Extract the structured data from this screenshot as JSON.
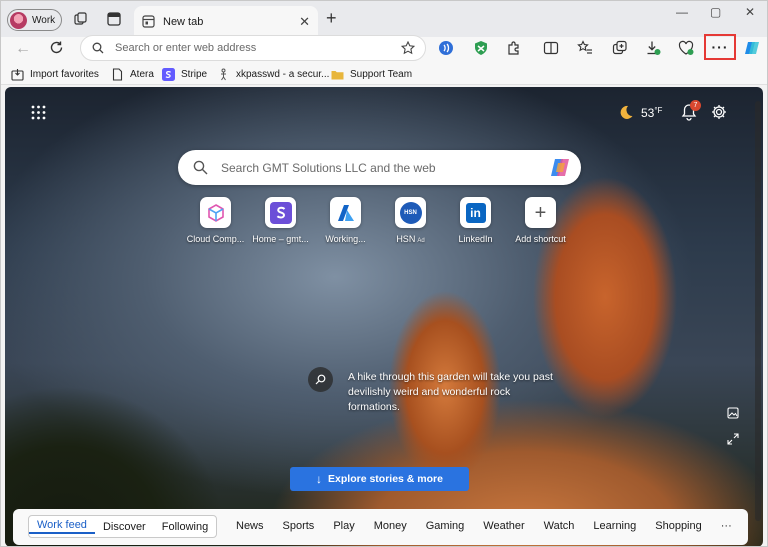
{
  "profile": {
    "label": "Work"
  },
  "tab": {
    "title": "New tab"
  },
  "window": {
    "minimize": "—",
    "restore": "▢",
    "close": "✕"
  },
  "toolbar": {
    "address_placeholder": "Search or enter web address",
    "more_label": "···"
  },
  "favorites": [
    {
      "label": "Import favorites"
    },
    {
      "label": "Atera"
    },
    {
      "label": "Stripe"
    },
    {
      "label": "xkpasswd - a secur..."
    },
    {
      "label": "Support Team"
    }
  ],
  "ntp": {
    "weather": {
      "temp": "53",
      "unit": "°F"
    },
    "notifications_count": "7",
    "search_placeholder": "Search GMT Solutions LLC and the web",
    "shortcuts": [
      {
        "label": "Cloud Comp...",
        "icon": "cube-icon"
      },
      {
        "label": "Home – gmt...",
        "icon": "s-letter-icon"
      },
      {
        "label": "Working...",
        "icon": "azure-icon"
      },
      {
        "label": "HSN",
        "ad": "Ad",
        "icon": "hsn-icon",
        "tile_text": "HSN"
      },
      {
        "label": "LinkedIn",
        "icon": "linkedin-icon",
        "tile_text": "in"
      },
      {
        "label": "Add shortcut",
        "icon": "plus-icon",
        "tile_text": "+"
      }
    ],
    "caption": "A hike through this garden will take you past devilishly weird and wonderful rock formations.",
    "explore_label": "Explore stories & more"
  },
  "feed": {
    "tabs": [
      {
        "label": "Work feed",
        "active": true
      },
      {
        "label": "Discover"
      },
      {
        "label": "Following"
      }
    ],
    "categories": [
      "News",
      "Sports",
      "Play",
      "Money",
      "Gaming",
      "Weather",
      "Watch",
      "Learning",
      "Shopping",
      "···"
    ]
  },
  "colors": {
    "accent": "#2a73e0",
    "highlight_box": "#e53935"
  }
}
